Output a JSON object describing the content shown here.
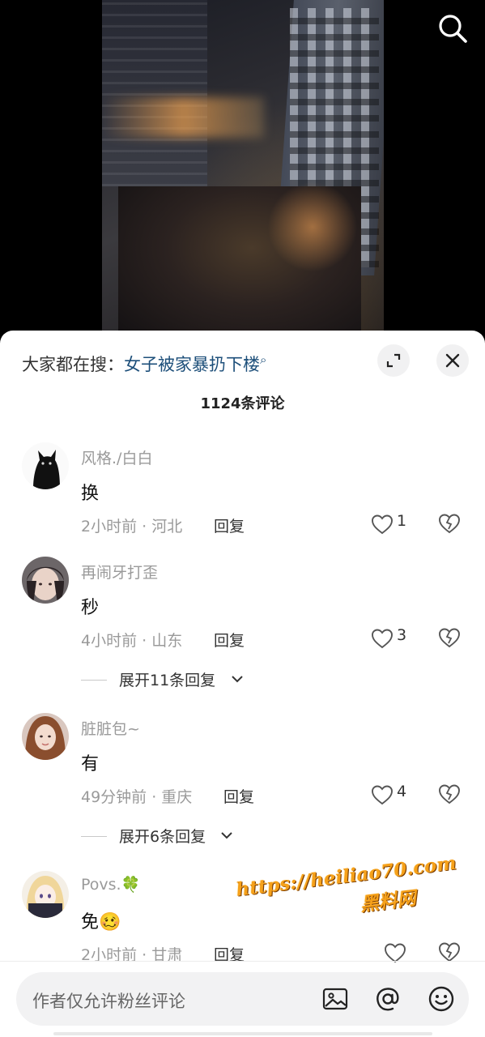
{
  "video": {
    "search_icon": "search-icon"
  },
  "sheet": {
    "trending_label": "大家都在搜：",
    "trending_query": "女子被家暴扔下楼",
    "trending_icon": "magnifier-icon",
    "expand_icon": "expand-icon",
    "close_icon": "close-icon",
    "comment_count": "1124条评论"
  },
  "comments": [
    {
      "username": "风格./白白",
      "text": "换",
      "meta": "2小时前 · 河北",
      "reply": "回复",
      "likes": "1",
      "expand": null
    },
    {
      "username": "再闹牙打歪",
      "text": "秒",
      "meta": "4小时前 · 山东",
      "reply": "回复",
      "likes": "3",
      "expand": "展开11条回复"
    },
    {
      "username": "脏脏包~",
      "text": "有",
      "meta": "49分钟前 · 重庆",
      "reply": "回复",
      "likes": "4",
      "expand": "展开6条回复"
    },
    {
      "username": "Povs.🍀",
      "text": "免🥴",
      "meta": "2小时前 · 甘肃",
      "reply": "回复",
      "likes": "",
      "expand": null
    }
  ],
  "watermark": {
    "line1": "https://heiliao70.com",
    "line2": "黑料网"
  },
  "input": {
    "placeholder": "作者仅允许粉丝评论",
    "image_icon": "image-icon",
    "at_icon": "at-icon",
    "emoji_icon": "emoji-icon"
  },
  "colors": {
    "link": "#1d4f7a",
    "muted_text": "#9a9a9a",
    "watermark": "#f6a11a"
  }
}
